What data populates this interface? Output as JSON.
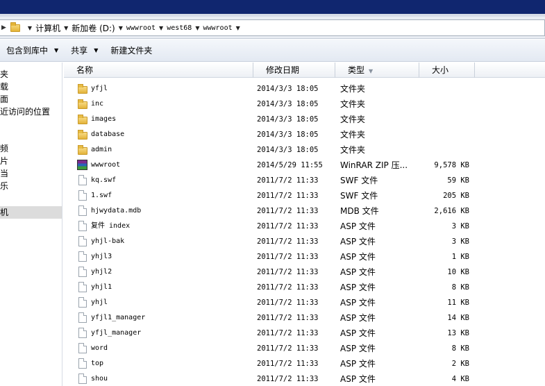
{
  "address": {
    "crumbs": [
      "计算机",
      "新加卷 (D:)",
      "wwwroot",
      "west68",
      "wwwroot"
    ]
  },
  "toolbar": {
    "include_label": "包含到库中",
    "share_label": "共享",
    "new_folder_label": "新建文件夹"
  },
  "nav": {
    "items": [
      "夹",
      "载",
      "面",
      "近访问的位置",
      "频",
      "片",
      "当",
      "乐",
      "机"
    ]
  },
  "columns": {
    "name": "名称",
    "date": "修改日期",
    "type": "类型",
    "size": "大小"
  },
  "files": [
    {
      "name": "yfjl",
      "date": "2014/3/3 18:05",
      "type": "文件夹",
      "size": "",
      "icon": "folder-icon"
    },
    {
      "name": "inc",
      "date": "2014/3/3 18:05",
      "type": "文件夹",
      "size": "",
      "icon": "folder-icon"
    },
    {
      "name": "images",
      "date": "2014/3/3 18:05",
      "type": "文件夹",
      "size": "",
      "icon": "folder-icon"
    },
    {
      "name": "database",
      "date": "2014/3/3 18:05",
      "type": "文件夹",
      "size": "",
      "icon": "folder-icon"
    },
    {
      "name": "admin",
      "date": "2014/3/3 18:05",
      "type": "文件夹",
      "size": "",
      "icon": "folder-icon"
    },
    {
      "name": "wwwroot",
      "date": "2014/5/29 11:55",
      "type": "WinRAR ZIP 压...",
      "size": "9,578 KB",
      "icon": "winrar-icon"
    },
    {
      "name": "kq.swf",
      "date": "2011/7/2 11:33",
      "type": "SWF 文件",
      "size": "59 KB",
      "icon": "file-icon"
    },
    {
      "name": "1.swf",
      "date": "2011/7/2 11:33",
      "type": "SWF 文件",
      "size": "205 KB",
      "icon": "file-icon"
    },
    {
      "name": "hjwydata.mdb",
      "date": "2011/7/2 11:33",
      "type": "MDB 文件",
      "size": "2,616 KB",
      "icon": "file-icon"
    },
    {
      "name": "复件 index",
      "date": "2011/7/2 11:33",
      "type": "ASP 文件",
      "size": "3 KB",
      "icon": "file-icon"
    },
    {
      "name": "yhjl-bak",
      "date": "2011/7/2 11:33",
      "type": "ASP 文件",
      "size": "3 KB",
      "icon": "file-icon"
    },
    {
      "name": "yhjl3",
      "date": "2011/7/2 11:33",
      "type": "ASP 文件",
      "size": "1 KB",
      "icon": "file-icon"
    },
    {
      "name": "yhjl2",
      "date": "2011/7/2 11:33",
      "type": "ASP 文件",
      "size": "10 KB",
      "icon": "file-icon"
    },
    {
      "name": "yhjl1",
      "date": "2011/7/2 11:33",
      "type": "ASP 文件",
      "size": "8 KB",
      "icon": "file-icon"
    },
    {
      "name": "yhjl",
      "date": "2011/7/2 11:33",
      "type": "ASP 文件",
      "size": "11 KB",
      "icon": "file-icon"
    },
    {
      "name": "yfjl1_manager",
      "date": "2011/7/2 11:33",
      "type": "ASP 文件",
      "size": "14 KB",
      "icon": "file-icon"
    },
    {
      "name": "yfjl_manager",
      "date": "2011/7/2 11:33",
      "type": "ASP 文件",
      "size": "13 KB",
      "icon": "file-icon"
    },
    {
      "name": "word",
      "date": "2011/7/2 11:33",
      "type": "ASP 文件",
      "size": "8 KB",
      "icon": "file-icon"
    },
    {
      "name": "top",
      "date": "2011/7/2 11:33",
      "type": "ASP 文件",
      "size": "2 KB",
      "icon": "file-icon"
    },
    {
      "name": "shou",
      "date": "2011/7/2 11:33",
      "type": "ASP 文件",
      "size": "4 KB",
      "icon": "file-icon"
    }
  ]
}
